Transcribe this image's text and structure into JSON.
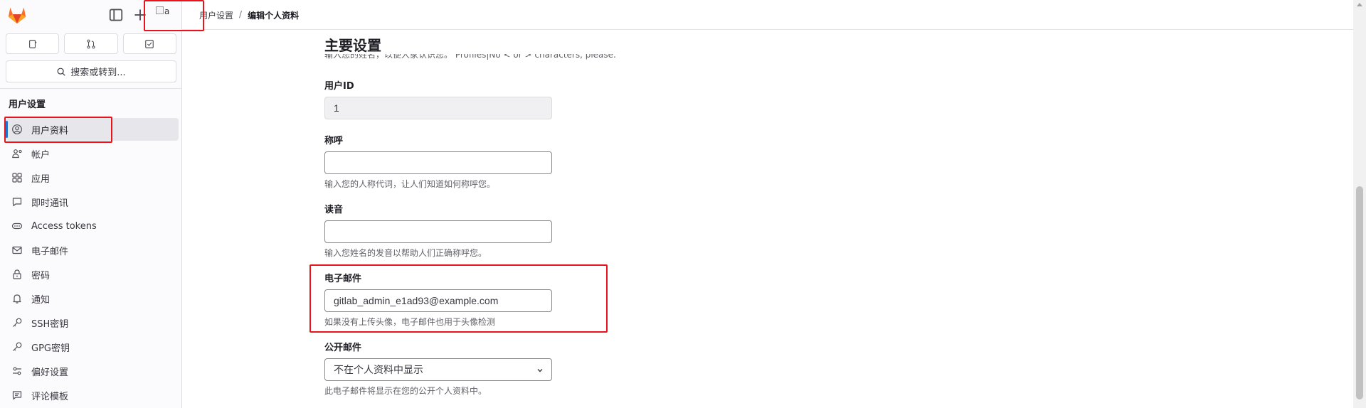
{
  "sidebar": {
    "search_label": "搜索或转到...",
    "section_heading": "用户设置",
    "items": [
      {
        "label": "用户资料",
        "icon": "profile-icon",
        "active": true
      },
      {
        "label": "帐户",
        "icon": "account-icon",
        "active": false
      },
      {
        "label": "应用",
        "icon": "applications-icon",
        "active": false
      },
      {
        "label": "即时通讯",
        "icon": "chat-icon",
        "active": false
      },
      {
        "label": "Access tokens",
        "icon": "token-icon",
        "active": false
      },
      {
        "label": "电子邮件",
        "icon": "mail-icon",
        "active": false
      },
      {
        "label": "密码",
        "icon": "lock-icon",
        "active": false
      },
      {
        "label": "通知",
        "icon": "bell-icon",
        "active": false
      },
      {
        "label": "SSH密钥",
        "icon": "key-icon",
        "active": false
      },
      {
        "label": "GPG密钥",
        "icon": "key-icon",
        "active": false
      },
      {
        "label": "偏好设置",
        "icon": "preferences-icon",
        "active": false
      },
      {
        "label": "评论模板",
        "icon": "comment-template-icon",
        "active": false
      }
    ]
  },
  "topbar": {
    "avatar_alt": "a",
    "breadcrumb": [
      "用户设置",
      "编辑个人资料"
    ]
  },
  "main": {
    "section_title": "主要设置",
    "cut_hint": "输入您的姓名，以便人家认识您。 Profiles|No  <  or  >  characters, please.",
    "fields": {
      "user_id": {
        "label": "用户ID",
        "value": "1"
      },
      "pronouns": {
        "label": "称呼",
        "value": "",
        "help": "输入您的人称代词，让人们知道如何称呼您。"
      },
      "pronunciation": {
        "label": "读音",
        "value": "",
        "help": "输入您姓名的发音以帮助人们正确称呼您。"
      },
      "email": {
        "label": "电子邮件",
        "value": "gitlab_admin_e1ad93@example.com",
        "help": "如果没有上传头像，电子邮件也用于头像检测"
      },
      "public_email": {
        "label": "公开邮件",
        "value": "不在个人资料中显示",
        "help": "此电子邮件将显示在您的公开个人资料中。"
      }
    }
  },
  "colors": {
    "accent": "#1f75cb",
    "highlight": "#e8141c",
    "logo": "#e24329"
  }
}
